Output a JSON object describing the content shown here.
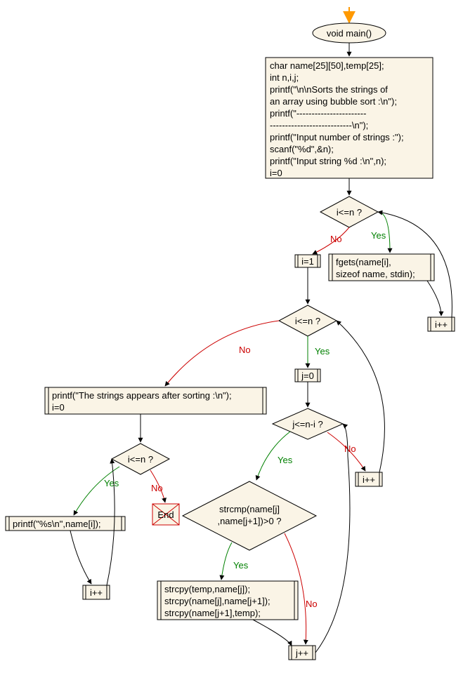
{
  "chart_data": {
    "type": "flowchart",
    "title": "",
    "nodes": [
      {
        "id": "start",
        "type": "start",
        "text": "void main()"
      },
      {
        "id": "init",
        "type": "process",
        "text": "char name[25][50],temp[25];\nint n,i,j;\nprintf(\"\\n\\nSorts the strings of\nan array using bubble sort :\\n\");\nprintf(\"-----------------------\n---------------------------\\n\");\nprintf(\"Input number of strings :\");\nscanf(\"%d\",&n);\nprintf(\"Input string %d :\\n\",n);\ni=0"
      },
      {
        "id": "cond1",
        "type": "decision",
        "text": "i<=n ?"
      },
      {
        "id": "fgets",
        "type": "process",
        "text": "fgets(name[i],\nsizeof name, stdin);"
      },
      {
        "id": "inc1",
        "type": "process",
        "text": "i++"
      },
      {
        "id": "seti1",
        "type": "process",
        "text": "i=1"
      },
      {
        "id": "cond2",
        "type": "decision",
        "text": "i<=n ?"
      },
      {
        "id": "setj0",
        "type": "process",
        "text": "j=0"
      },
      {
        "id": "cond3",
        "type": "decision",
        "text": "j<=n-i ?"
      },
      {
        "id": "cond4",
        "type": "decision",
        "text": "strcmp(name[j]\n,name[j+1])>0 ?"
      },
      {
        "id": "swap",
        "type": "process",
        "text": "strcpy(temp,name[j]);\nstrcpy(name[j],name[j+1]);\nstrcpy(name[j+1],temp);"
      },
      {
        "id": "incj",
        "type": "process",
        "text": "j++"
      },
      {
        "id": "inci2",
        "type": "process",
        "text": "i++"
      },
      {
        "id": "print_head",
        "type": "process",
        "text": "printf(\"The strings appears after sorting :\\n\");\ni=0"
      },
      {
        "id": "cond5",
        "type": "decision",
        "text": "i<=n ?"
      },
      {
        "id": "print",
        "type": "process",
        "text": "printf(\"%s\\n\",name[i]);"
      },
      {
        "id": "inci3",
        "type": "process",
        "text": "i++"
      },
      {
        "id": "end",
        "type": "end",
        "text": "End"
      }
    ],
    "edges": [
      {
        "from": "start",
        "to": "init"
      },
      {
        "from": "init",
        "to": "cond1"
      },
      {
        "from": "cond1",
        "to": "fgets",
        "label": "Yes"
      },
      {
        "from": "fgets",
        "to": "inc1"
      },
      {
        "from": "inc1",
        "to": "cond1"
      },
      {
        "from": "cond1",
        "to": "seti1",
        "label": "No"
      },
      {
        "from": "seti1",
        "to": "cond2"
      },
      {
        "from": "cond2",
        "to": "setj0",
        "label": "Yes"
      },
      {
        "from": "setj0",
        "to": "cond3"
      },
      {
        "from": "cond3",
        "to": "cond4",
        "label": "Yes"
      },
      {
        "from": "cond3",
        "to": "inci2",
        "label": "No"
      },
      {
        "from": "inci2",
        "to": "cond2"
      },
      {
        "from": "cond4",
        "to": "swap",
        "label": "Yes"
      },
      {
        "from": "swap",
        "to": "incj"
      },
      {
        "from": "cond4",
        "to": "incj",
        "label": "No"
      },
      {
        "from": "incj",
        "to": "cond3"
      },
      {
        "from": "cond2",
        "to": "print_head",
        "label": "No"
      },
      {
        "from": "print_head",
        "to": "cond5"
      },
      {
        "from": "cond5",
        "to": "print",
        "label": "Yes"
      },
      {
        "from": "print",
        "to": "inci3"
      },
      {
        "from": "inci3",
        "to": "cond5"
      },
      {
        "from": "cond5",
        "to": "end",
        "label": "No"
      }
    ]
  },
  "n": {
    "start": "void main()",
    "init_l1": "char name[25][50],temp[25];",
    "init_l2": "int n,i,j;",
    "init_l3": "printf(\"\\n\\nSorts the strings of",
    "init_l4": "an array using bubble sort :\\n\");",
    "init_l5": "printf(\"-----------------------",
    "init_l6": "---------------------------\\n\");",
    "init_l7": "printf(\"Input number of strings :\");",
    "init_l8": "scanf(\"%d\",&n);",
    "init_l9": "printf(\"Input string %d :\\n\",n);",
    "init_l10": "i=0",
    "cond1": "i<=n ?",
    "fgets_l1": "fgets(name[i],",
    "fgets_l2": "sizeof name, stdin);",
    "inc1": "i++",
    "seti1": "i=1",
    "cond2": "i<=n ?",
    "setj0": "j=0",
    "cond3": "j<=n-i ?",
    "cond4_l1": "strcmp(name[j]",
    "cond4_l2": ",name[j+1])>0 ?",
    "swap_l1": "strcpy(temp,name[j]);",
    "swap_l2": "strcpy(name[j],name[j+1]);",
    "swap_l3": "strcpy(name[j+1],temp);",
    "incj": "j++",
    "inci2": "i++",
    "print_head_l1": "printf(\"The strings appears after sorting :\\n\");",
    "print_head_l2": "i=0",
    "cond5": "i<=n ?",
    "print": "printf(\"%s\\n\",name[i]);",
    "inci3": "i++",
    "end": "End",
    "yes": "Yes",
    "no": "No"
  }
}
